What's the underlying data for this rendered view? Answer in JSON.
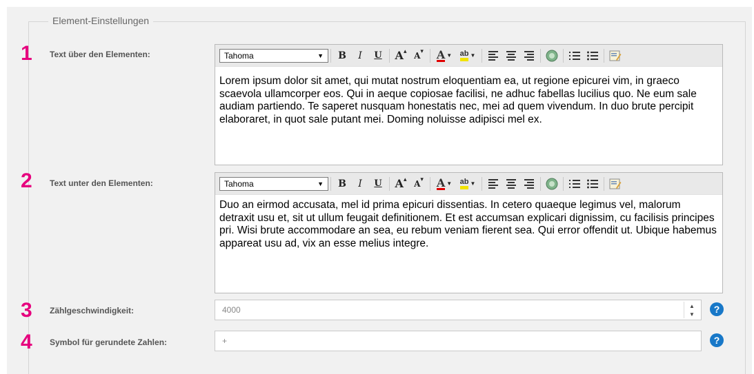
{
  "section": {
    "legend": "Element-Einstellungen"
  },
  "fields": [
    {
      "number": "1",
      "label": "Text über den Elementen:"
    },
    {
      "number": "2",
      "label": "Text unter den Elementen:"
    },
    {
      "number": "3",
      "label": "Zählgeschwindigkeit:"
    },
    {
      "number": "4",
      "label": "Symbol für gerundete Zahlen:"
    }
  ],
  "toolbar": {
    "font_name": "Tahoma",
    "bold": "B",
    "italic": "I",
    "underline": "U",
    "font_larger": "A",
    "font_smaller": "A",
    "text_color": "A",
    "highlight": "ab",
    "colors": {
      "text_color_bar": "#e00000",
      "highlight_bar": "#f2e300"
    }
  },
  "editor_top": {
    "text": "Lorem ipsum dolor sit amet, qui mutat nostrum eloquentiam ea, ut regione epicurei vim, in graeco scaevola ullamcorper eos. Qui in aeque copiosae facilisi, ne adhuc fabellas lucilius quo. Ne eum sale audiam partiendo. Te saperet nusquam honestatis nec, mei ad quem vivendum. In duo brute percipit elaboraret, in quot sale putant mei. Doming noluisse adipisci mel ex."
  },
  "editor_bottom": {
    "text": "Duo an eirmod accusata, mel id prima epicuri dissentias. In cetero quaeque legimus vel, malorum detraxit usu et, sit ut ullum feugait definitionem. Et est accumsan explicari dignissim, cu facilisis principes pri. Wisi brute accommodare an sea, eu rebum veniam fierent sea. Qui error offendit ut. Ubique habemus appareat usu ad, vix an esse melius integre."
  },
  "speed_input": {
    "value": "4000"
  },
  "symbol_input": {
    "value": "+"
  },
  "help": {
    "label": "?"
  },
  "accent_color": "#e6007e"
}
